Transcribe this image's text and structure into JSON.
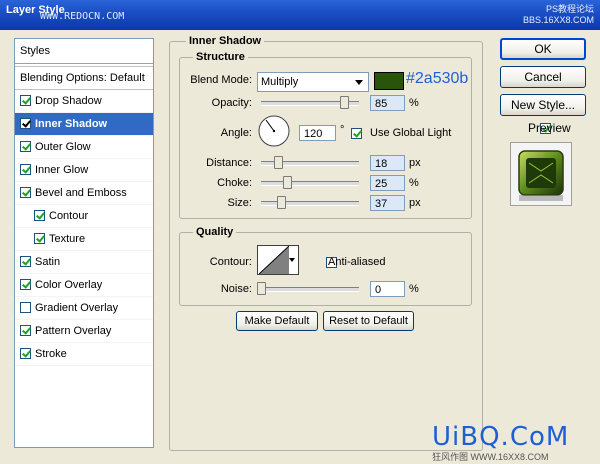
{
  "window": {
    "title": "Layer Style",
    "watermark_left": "WWW.REDOCN.COM",
    "watermark_right_1": "PS教程论坛",
    "watermark_right_2": "BBS.16XX8.COM"
  },
  "styles_panel": {
    "header": "Styles",
    "blending_options": "Blending Options: Default",
    "items": [
      {
        "label": "Drop Shadow",
        "checked": true,
        "sub": false,
        "selected": false
      },
      {
        "label": "Inner Shadow",
        "checked": true,
        "sub": false,
        "selected": true
      },
      {
        "label": "Outer Glow",
        "checked": true,
        "sub": false,
        "selected": false
      },
      {
        "label": "Inner Glow",
        "checked": true,
        "sub": false,
        "selected": false
      },
      {
        "label": "Bevel and Emboss",
        "checked": true,
        "sub": false,
        "selected": false
      },
      {
        "label": "Contour",
        "checked": true,
        "sub": true,
        "selected": false
      },
      {
        "label": "Texture",
        "checked": true,
        "sub": true,
        "selected": false
      },
      {
        "label": "Satin",
        "checked": true,
        "sub": false,
        "selected": false
      },
      {
        "label": "Color Overlay",
        "checked": true,
        "sub": false,
        "selected": false
      },
      {
        "label": "Gradient Overlay",
        "checked": false,
        "sub": false,
        "selected": false
      },
      {
        "label": "Pattern Overlay",
        "checked": true,
        "sub": false,
        "selected": false
      },
      {
        "label": "Stroke",
        "checked": true,
        "sub": false,
        "selected": false
      }
    ]
  },
  "inner_shadow": {
    "title": "Inner Shadow",
    "structure": {
      "title": "Structure",
      "blend_mode_label": "Blend Mode:",
      "blend_mode_value": "Multiply",
      "color_hex": "#2a530b",
      "opacity_label": "Opacity:",
      "opacity_value": "85",
      "opacity_unit": "%",
      "angle_label": "Angle:",
      "angle_value": "120",
      "angle_unit": "°",
      "global_light_label": "Use Global Light",
      "global_light_checked": true,
      "distance_label": "Distance:",
      "distance_value": "18",
      "distance_unit": "px",
      "choke_label": "Choke:",
      "choke_value": "25",
      "choke_unit": "%",
      "size_label": "Size:",
      "size_value": "37",
      "size_unit": "px"
    },
    "quality": {
      "title": "Quality",
      "contour_label": "Contour:",
      "anti_aliased_label": "Anti-aliased",
      "anti_aliased_checked": false,
      "noise_label": "Noise:",
      "noise_value": "0",
      "noise_unit": "%"
    },
    "make_default": "Make Default",
    "reset_default": "Reset to Default"
  },
  "buttons": {
    "ok": "OK",
    "cancel": "Cancel",
    "new_style": "New Style...",
    "preview_label": "Preview",
    "preview_checked": true
  },
  "footer_watermark": {
    "brand": "UiBQ.CoM",
    "sub": "狂风作图 WWW.16XX8.COM"
  },
  "colors": {
    "selection": "#316ac5",
    "shadow_color": "#2a530b",
    "brand_blue": "#1f5fd6"
  }
}
